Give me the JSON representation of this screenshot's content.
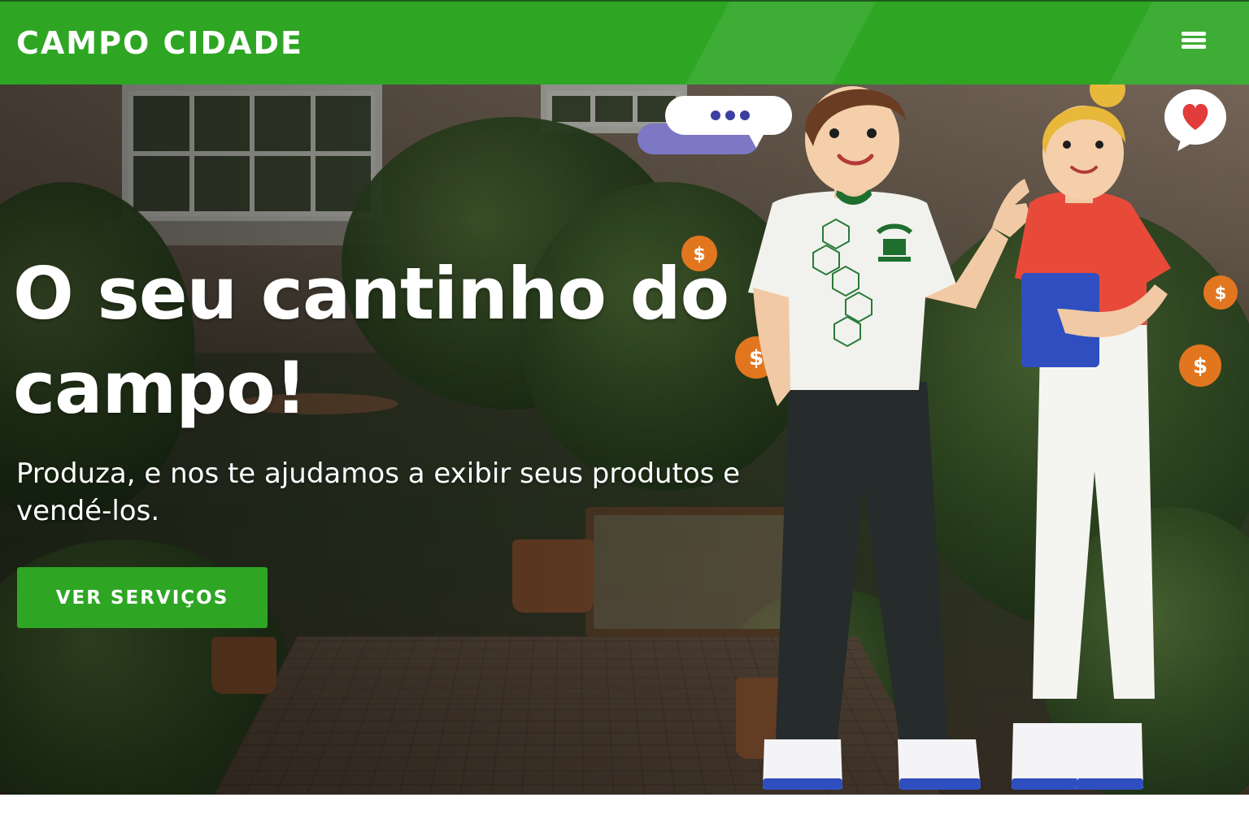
{
  "header": {
    "brand": "CAMPO CIDADE",
    "menu_icon": "hamburger-menu-icon"
  },
  "hero": {
    "title": "O seu cantinho do\ncampo!",
    "subtitle": "Produza, e nos te ajudamos a exibir seus produtos e vendé-los.",
    "cta_label": "VER SERVIÇOS"
  },
  "illustration": {
    "speech_bubble_icon": "chat-bubble-icon",
    "heart_icon": "heart-bubble-icon",
    "coin_icon": "dollar-coin-icon"
  },
  "colors": {
    "brand_green": "#2ea624",
    "text_white": "#ffffff",
    "coin_orange": "#e2761f",
    "heart_red": "#e23b3b"
  }
}
